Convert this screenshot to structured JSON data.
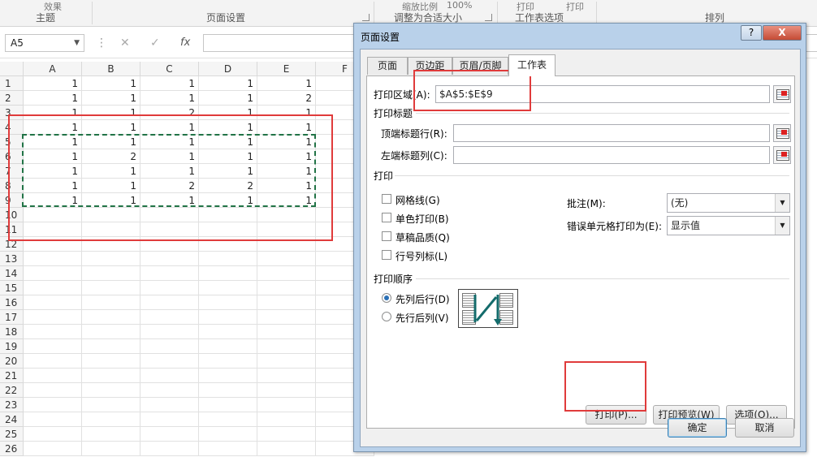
{
  "ribbon": {
    "top_fragments": [
      "效果",
      "缩放比例",
      "100%",
      "打印",
      "打印"
    ],
    "groups": [
      "主题",
      "页面设置",
      "调整为合适大小",
      "工作表选项",
      "排列"
    ]
  },
  "formula_bar": {
    "name_box": "A5",
    "cancel": "✕",
    "enter": "✓",
    "fx": "fx",
    "formula": ""
  },
  "sheet": {
    "columns": [
      "A",
      "B",
      "C",
      "D",
      "E",
      "F"
    ],
    "rows": [
      "1",
      "2",
      "3",
      "4",
      "5",
      "6",
      "7",
      "8",
      "9",
      "10",
      "11",
      "12",
      "13",
      "14",
      "15",
      "16",
      "17",
      "18",
      "19",
      "20",
      "21",
      "22",
      "23",
      "24",
      "25",
      "26"
    ],
    "data": [
      [
        "1",
        "1",
        "1",
        "1",
        "1"
      ],
      [
        "1",
        "1",
        "1",
        "1",
        "2"
      ],
      [
        "1",
        "1",
        "2",
        "1",
        "1"
      ],
      [
        "1",
        "1",
        "1",
        "1",
        "1"
      ],
      [
        "1",
        "1",
        "1",
        "1",
        "1"
      ],
      [
        "1",
        "2",
        "1",
        "1",
        "1"
      ],
      [
        "1",
        "1",
        "1",
        "1",
        "1"
      ],
      [
        "1",
        "1",
        "2",
        "2",
        "1"
      ],
      [
        "1",
        "1",
        "1",
        "1",
        "1"
      ]
    ]
  },
  "dialog": {
    "title": "页面设置",
    "help_btn": "?",
    "close_btn": "X",
    "tabs": [
      "页面",
      "页边距",
      "页眉/页脚",
      "工作表"
    ],
    "print_area_label": "打印区域(A):",
    "print_area_value": "$A$5:$E$9",
    "print_titles_section": "打印标题",
    "top_rows_label": "顶端标题行(R):",
    "top_rows_value": "",
    "left_cols_label": "左端标题列(C):",
    "left_cols_value": "",
    "print_section": "打印",
    "checkboxes": [
      "网格线(G)",
      "单色打印(B)",
      "草稿品质(Q)",
      "行号列标(L)"
    ],
    "comments_label": "批注(M):",
    "comments_value": "(无)",
    "errors_label": "错误单元格打印为(E):",
    "errors_value": "显示值",
    "order_section": "打印顺序",
    "order_options": [
      "先列后行(D)",
      "先行后列(V)"
    ],
    "buttons": {
      "print": "打印(P)...",
      "preview": "打印预览(W)",
      "options": "选项(O)...",
      "ok": "确定",
      "cancel": "取消"
    }
  },
  "colors": {
    "highlight": "#e03b3b",
    "marquee": "#217346",
    "dialog_frame": "#b9d1ea"
  }
}
